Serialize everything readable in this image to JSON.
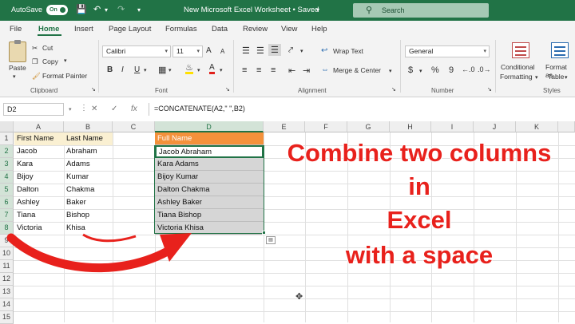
{
  "titlebar": {
    "autosave_label": "AutoSave",
    "autosave_state": "On",
    "doc_title": "New Microsoft Excel Worksheet • Saved",
    "search_placeholder": "Search"
  },
  "menu": [
    "File",
    "Home",
    "Insert",
    "Page Layout",
    "Formulas",
    "Data",
    "Review",
    "View",
    "Help"
  ],
  "active_tab": "Home",
  "ribbon": {
    "clipboard": {
      "paste": "Paste",
      "cut": "Cut",
      "copy": "Copy",
      "format_painter": "Format Painter",
      "group": "Clipboard"
    },
    "font": {
      "family": "Calibri",
      "size": "11",
      "bold": "B",
      "italic": "I",
      "underline": "U",
      "grow": "A",
      "shrink": "A",
      "group": "Font"
    },
    "alignment": {
      "wrap_text": "Wrap Text",
      "merge_center": "Merge & Center",
      "group": "Alignment"
    },
    "number": {
      "format": "General",
      "currency": "$",
      "percent": "%",
      "comma": "9",
      "group": "Number"
    },
    "styles": {
      "conditional": "Conditional",
      "conditional2": "Formatting",
      "format_as": "Format as",
      "format_as2": "Table",
      "group": "Styles"
    }
  },
  "formula_bar": {
    "name_box": "D2",
    "cancel": "✕",
    "enter": "✓",
    "fx": "fx",
    "formula": "=CONCATENATE(A2,\" \",B2)"
  },
  "columns": [
    "A",
    "B",
    "C",
    "D",
    "E",
    "F",
    "G",
    "H",
    "I",
    "J",
    "K"
  ],
  "rows": [
    "1",
    "2",
    "3",
    "4",
    "5",
    "6",
    "7",
    "8",
    "9",
    "10",
    "11",
    "12",
    "13",
    "14",
    "15"
  ],
  "sheet": {
    "headers": {
      "a": "First Name",
      "b": "Last Name",
      "d": "Full Name"
    },
    "data": [
      {
        "a": "Jacob",
        "b": "Abraham",
        "d": "Jacob Abraham"
      },
      {
        "a": "Kara",
        "b": "Adams",
        "d": "Kara Adams"
      },
      {
        "a": "Bijoy",
        "b": "Kumar",
        "d": "Bijoy Kumar"
      },
      {
        "a": "Dalton",
        "b": "Chakma",
        "d": "Dalton Chakma"
      },
      {
        "a": "Ashley",
        "b": "Baker",
        "d": "Ashley Baker"
      },
      {
        "a": "Tiana",
        "b": "Bishop",
        "d": "Tiana Bishop"
      },
      {
        "a": "Victoria",
        "b": "Khisa",
        "d": "Victoria Khisa"
      }
    ]
  },
  "overlay": {
    "line1": "Combine two columns",
    "line2": "in",
    "line3": "Excel",
    "line4": "with a space"
  },
  "colors": {
    "accent": "#217346",
    "header_fill": "#f4913b",
    "overlay_text": "#e8211c"
  }
}
